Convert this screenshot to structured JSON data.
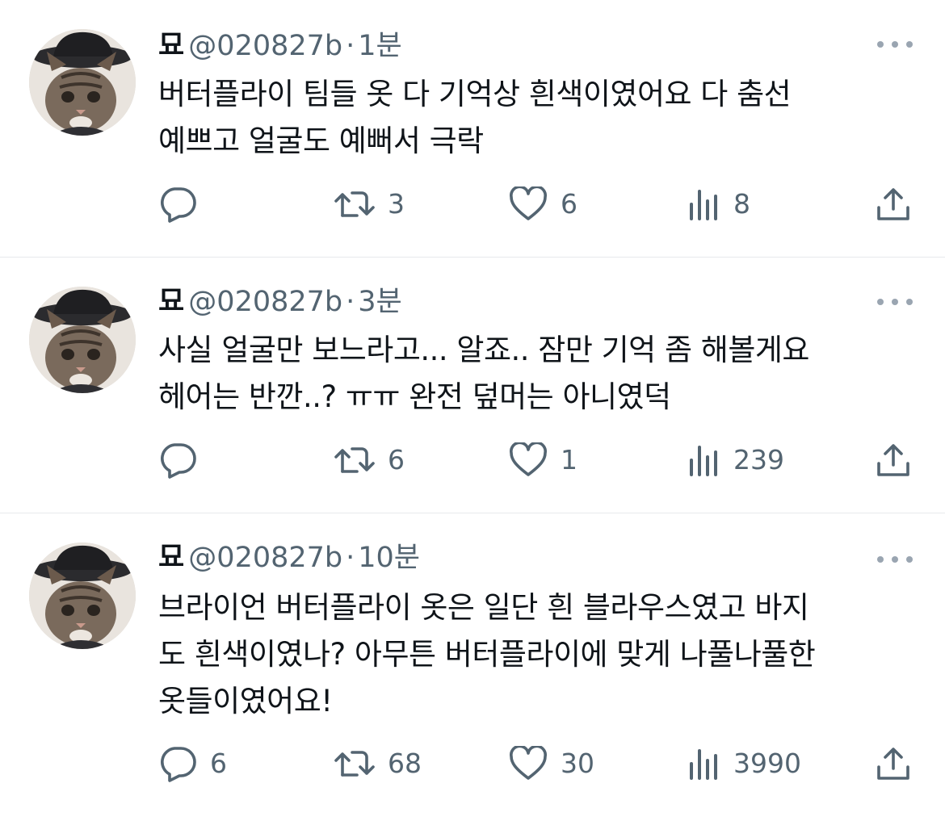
{
  "colors": {
    "text": "#0f1419",
    "secondary": "#536471",
    "divider": "#e7e9ec",
    "icon": "#536471"
  },
  "tweets": [
    {
      "name": "묘",
      "handle": "@020827b",
      "separator": "·",
      "time": "1분",
      "lines": [
        "버터플라이 팀들 옷 다 기억상 흰색이였어요 다 춤선",
        "예쁘고 얼굴도 예뻐서 극락"
      ],
      "reply_count": "",
      "retweet_count": "3",
      "like_count": "6",
      "view_count": "8"
    },
    {
      "name": "묘",
      "handle": "@020827b",
      "separator": "·",
      "time": "3분",
      "lines": [
        "사실 얼굴만 보느라고... 알죠.. 잠만 기억 좀 해볼게요",
        "헤어는 반깐..? ㅠㅠ 완전 덮머는 아니였덕"
      ],
      "reply_count": "",
      "retweet_count": "6",
      "like_count": "1",
      "view_count": "239"
    },
    {
      "name": "묘",
      "handle": "@020827b",
      "separator": "·",
      "time": "10분",
      "lines": [
        "브라이언 버터플라이 옷은 일단 흰 블라우스였고 바지",
        "도 흰색이였나? 아무튼 버터플라이에 맞게 나풀나풀한",
        "옷들이였어요!"
      ],
      "reply_count": "6",
      "retweet_count": "68",
      "like_count": "30",
      "view_count": "3990"
    }
  ]
}
